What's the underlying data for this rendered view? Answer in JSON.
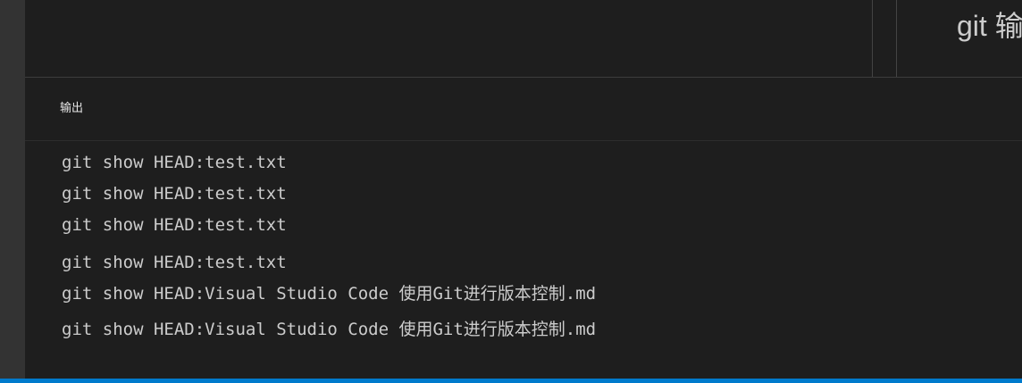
{
  "editor": {
    "preview_title": "git 输"
  },
  "panel": {
    "title": "输出"
  },
  "output": {
    "lines": [
      "git show HEAD:test.txt",
      "git show HEAD:test.txt",
      "git show HEAD:test.txt",
      "git show HEAD:test.txt",
      "git show HEAD:Visual Studio Code 使用Git进行版本控制.md",
      "git show HEAD:Visual Studio Code 使用Git进行版本控制.md"
    ]
  },
  "colors": {
    "background": "#1e1e1e",
    "activity_bar": "#333333",
    "text": "#cccccc",
    "status_bar": "#007acc"
  }
}
